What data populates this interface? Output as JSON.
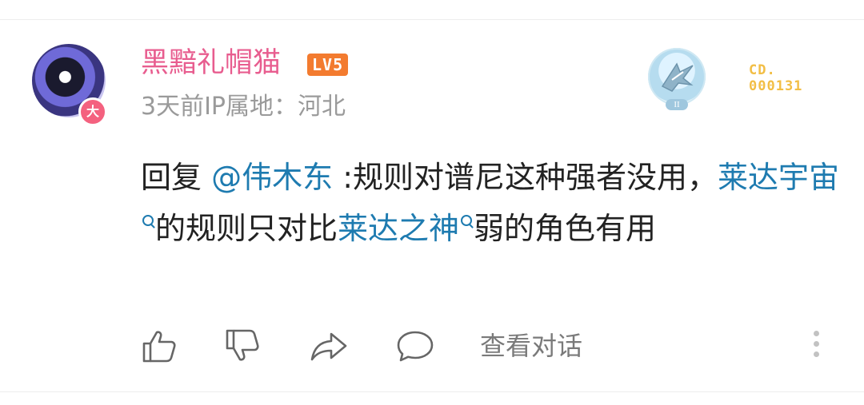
{
  "comment": {
    "user": {
      "name": "黑黯礼帽猫",
      "level": "LV5",
      "avatar_badge": "大",
      "avatar": "avatar-image"
    },
    "meta": "3天前IP属地：河北",
    "medal": {
      "roman": "II",
      "code_line1": "CD.",
      "code_line2": "000131"
    },
    "reply": {
      "prefix": "回复 ",
      "mention": "@伟木东",
      "text1": " :规则对谱尼这种强者没用，",
      "topic1": "莱达宇宙",
      "text2": "的规则只对比",
      "topic2": "莱达之神",
      "text3": "弱的角色有用"
    },
    "actions": {
      "like_icon": "thumbs-up-icon",
      "dislike_icon": "thumbs-down-icon",
      "share_icon": "share-icon",
      "reply_icon": "comment-icon",
      "view_conversation": "查看对话",
      "more_icon": "more-vertical-icon"
    },
    "colors": {
      "username": "#e85d8f",
      "level_badge": "#f37b2f",
      "link": "#1e7bb0",
      "medal_code": "#f2be45",
      "meta": "#9a9a9a"
    }
  }
}
